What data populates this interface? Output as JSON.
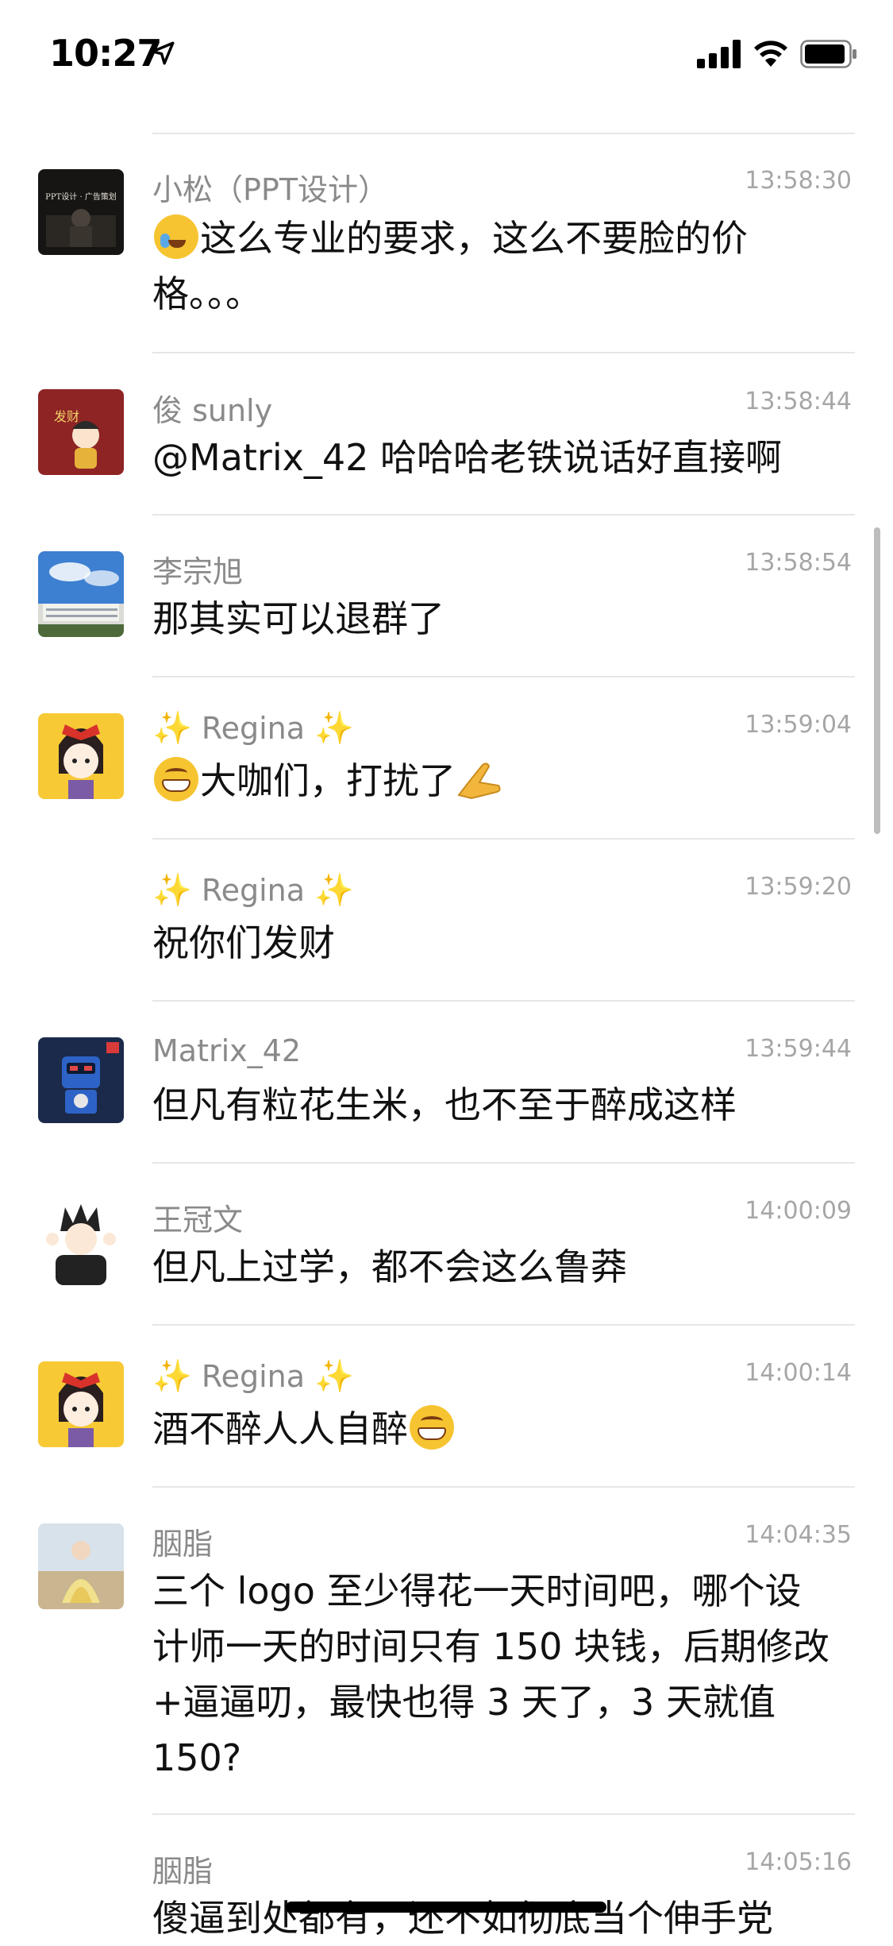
{
  "status_bar": {
    "time": "10:27"
  },
  "messages": [
    {
      "sender": "小松（PPT设计）",
      "time": "13:58:30",
      "text_lines": [
        "这么专业的要求，这么不要脸的价",
        "格。。。"
      ]
    },
    {
      "sender": "俊 sunly",
      "time": "13:58:44",
      "text": "@Matrix_42 哈哈哈老铁说话好直接啊"
    },
    {
      "sender": "李宗旭",
      "time": "13:58:54",
      "text": "那其实可以退群了"
    },
    {
      "sender": "Regina",
      "time": "13:59:04",
      "text": "大咖们，打扰了"
    },
    {
      "sender": "Regina",
      "time": "13:59:20",
      "text": "祝你们发财"
    },
    {
      "sender": "Matrix_42",
      "time": "13:59:44",
      "text": "但凡有粒花生米，也不至于醉成这样"
    },
    {
      "sender": "王冠文",
      "time": "14:00:09",
      "text": "但凡上过学，都不会这么鲁莽"
    },
    {
      "sender": "Regina",
      "time": "14:00:14",
      "text": "酒不醉人人自醉"
    },
    {
      "sender": "胭脂",
      "time": "14:04:35",
      "text_lines": [
        "三个 logo 至少得花一天时间吧，哪个设",
        "计师一天的时间只有 150 块钱，后期修改",
        "+逼逼叨，最快也得 3 天了，3 天就值",
        "150?"
      ]
    },
    {
      "sender": "胭脂",
      "time": "14:05:16",
      "text": "傻逼到处都有，还不如彻底当个伸手党"
    }
  ],
  "avatar_texts": {
    "ppt": "PPT设计 · 广告策划",
    "facai": "发财"
  },
  "colors": {
    "divider": "#e6e6e6",
    "sender": "#8a8a8a",
    "time": "#a6a6a6",
    "text": "#111111"
  }
}
